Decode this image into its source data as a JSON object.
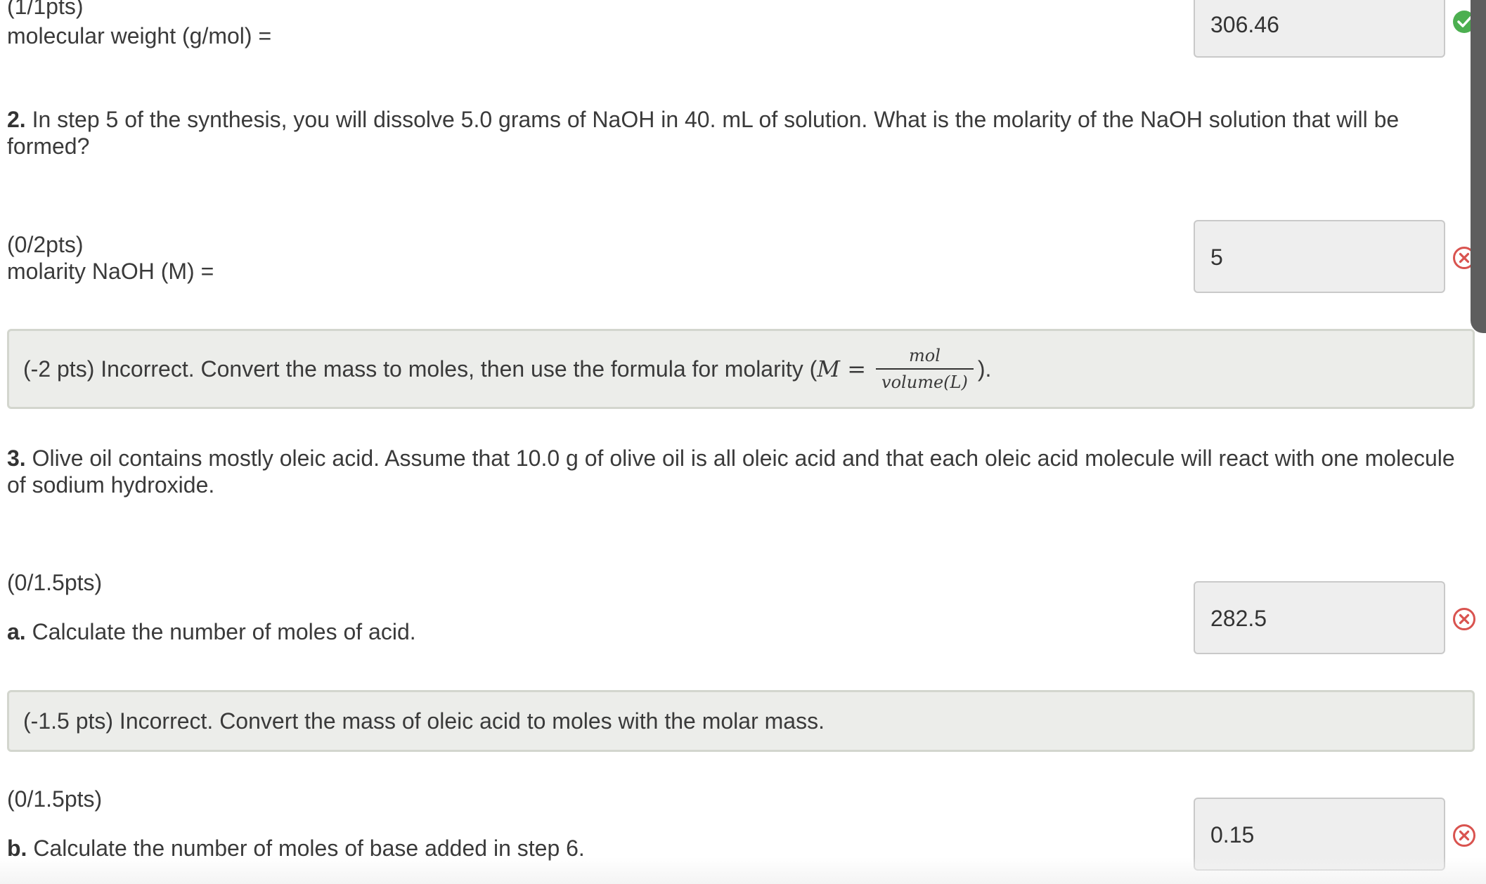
{
  "items": [
    {
      "points": "(1/1pts)",
      "label": "molecular weight (g/mol) =",
      "answer": "306.46",
      "status": "correct"
    }
  ],
  "q2": {
    "number": "2.",
    "text": "In step 5 of the synthesis, you will dissolve 5.0 grams of NaOH in 40. mL of solution. What is the molarity of the NaOH solution that will be formed?",
    "points": "(0/2pts)",
    "label": "molarity NaOH (M) =",
    "answer": "5",
    "status": "incorrect",
    "feedback_prefix": "(-2 pts) Incorrect. Convert the mass to moles, then use the formula for molarity (",
    "formula_lhs": "M =",
    "formula_num": "mol",
    "formula_den": "volume(L)",
    "feedback_suffix": ")."
  },
  "q3": {
    "number": "3.",
    "text": "Olive oil contains mostly oleic acid. Assume that 10.0 g of olive oil is all oleic acid and that each oleic acid molecule will react with one molecule of sodium hydroxide.",
    "parts": [
      {
        "points": "(0/1.5pts)",
        "letter": "a.",
        "text": "Calculate the number of moles of acid.",
        "answer": "282.5",
        "status": "incorrect",
        "feedback": "(-1.5 pts) Incorrect. Convert the mass of oleic acid to moles with the molar mass."
      },
      {
        "points": "(0/1.5pts)",
        "letter": "b.",
        "text": "Calculate the number of moles of base added in step 6.",
        "answer": "0.15",
        "status": "incorrect"
      }
    ]
  },
  "icons": {
    "correct": "check-circle-icon",
    "incorrect": "x-circle-icon"
  },
  "colors": {
    "correct": "#4caf50",
    "incorrect": "#d9534f",
    "feedback_bg": "#ecedea",
    "answer_bg": "#eeeeee"
  }
}
